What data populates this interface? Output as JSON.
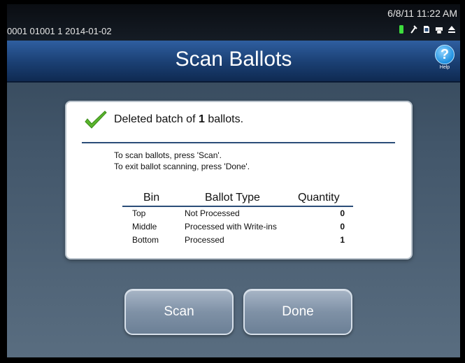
{
  "status_bar": {
    "id_date": "0001 01001 1   2014-01-02",
    "datetime": "6/8/11  11:22 AM",
    "icons": [
      "battery-icon",
      "plug-icon",
      "memory-card-icon",
      "printer-icon",
      "eject-icon"
    ]
  },
  "header": {
    "title": "Scan Ballots",
    "help_label": "Help"
  },
  "dialog": {
    "headline_prefix": "Deleted batch of ",
    "headline_count": "1",
    "headline_suffix": " ballots.",
    "instructions": [
      "To scan ballots, press 'Scan'.",
      "To exit ballot scanning, press 'Done'."
    ],
    "table": {
      "headers": [
        "Bin",
        "Ballot Type",
        "Quantity"
      ],
      "rows": [
        {
          "bin": "Top",
          "type": "Not Processed",
          "qty": "0"
        },
        {
          "bin": "Middle",
          "type": "Processed with Write-ins",
          "qty": "0"
        },
        {
          "bin": "Bottom",
          "type": "Processed",
          "qty": "1"
        }
      ]
    }
  },
  "buttons": {
    "scan": "Scan",
    "done": "Done"
  },
  "colors": {
    "title_bar": "#1a3f72",
    "check": "#5ab52c",
    "rule": "#2b4d78"
  }
}
